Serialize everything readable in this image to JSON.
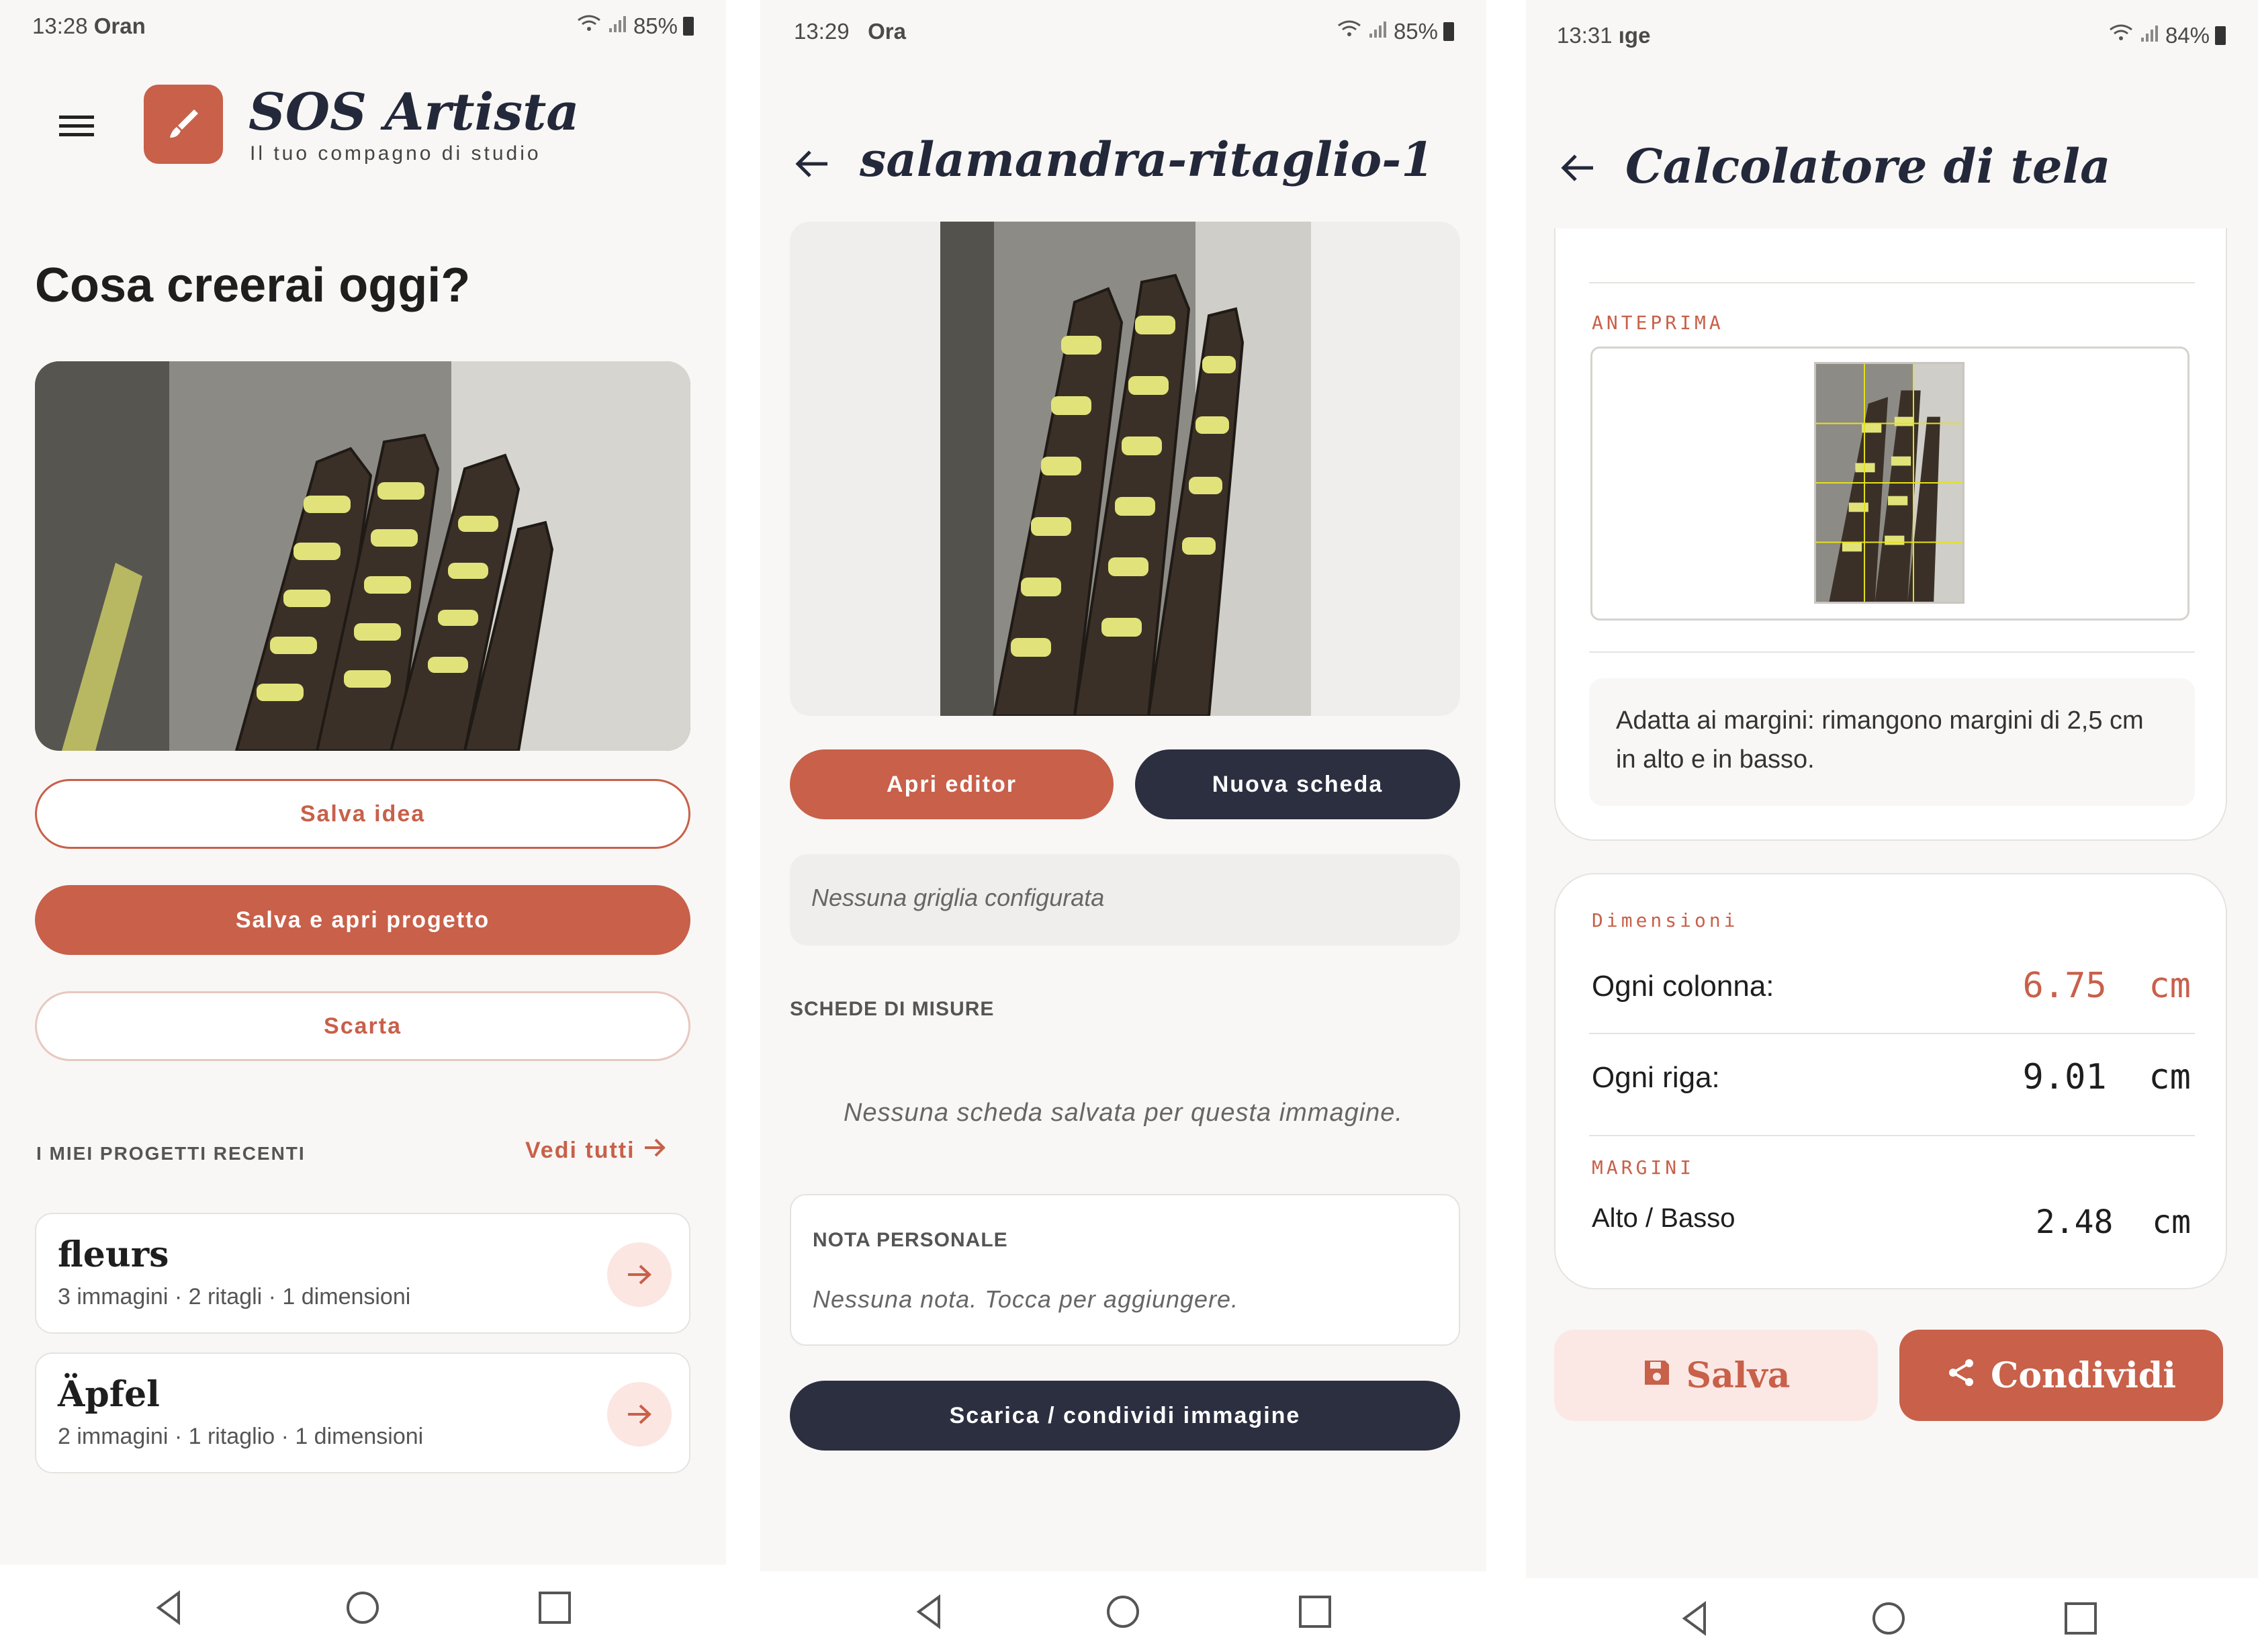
{
  "screen1": {
    "status": {
      "time": "13:28",
      "carrier": "Oran",
      "battery": "85%"
    },
    "app_title": "SOS Artista",
    "app_subtitle": "Il tuo compagno di studio",
    "heading": "Cosa creerai oggi?",
    "buttons": {
      "save_idea": "Salva idea",
      "save_open": "Salva e apri progetto",
      "discard": "Scarta"
    },
    "recent_label": "I MIEI PROGETTI RECENTI",
    "see_all": "Vedi tutti",
    "projects": [
      {
        "name": "fleurs",
        "meta": "3 immagini · 2 ritagli · 1 dimensioni"
      },
      {
        "name": "Äpfel",
        "meta": "2 immagini · 1 ritaglio · 1 dimensioni"
      }
    ]
  },
  "screen2": {
    "status": {
      "time": "13:29",
      "carrier": "Ora",
      "battery": "85%"
    },
    "title": "salamandra-ritaglio-1",
    "buttons": {
      "open_editor": "Apri editor",
      "new_sheet": "Nuova scheda",
      "download_share": "Scarica / condividi immagine"
    },
    "grid_placeholder": "Nessuna griglia configurata",
    "sheets_label": "SCHEDE DI MISURE",
    "sheets_empty": "Nessuna scheda salvata per questa immagine.",
    "note_label": "NOTA PERSONALE",
    "note_placeholder": "Nessuna nota. Tocca per aggiungere."
  },
  "screen3": {
    "status": {
      "time": "13:31",
      "carrier": "ıge",
      "battery": "84%"
    },
    "title": "Calcolatore di tela",
    "preview_label": "ANTEPRIMA",
    "fit_message": "Adatta ai margini: rimangono margini di 2,5 cm in alto e in basso.",
    "dimensions_label": "Dimensioni",
    "rows": [
      {
        "label": "Ogni colonna:",
        "value": "6.75",
        "unit": "cm"
      },
      {
        "label": "Ogni riga:",
        "value": "9.01",
        "unit": "cm"
      }
    ],
    "margins_label": "MARGINI",
    "margin_row": {
      "label": "Alto / Basso",
      "value": "2.48",
      "unit": "cm"
    },
    "buttons": {
      "save": "Salva",
      "share": "Condividi"
    }
  },
  "colors": {
    "accent": "#c8604a",
    "navy": "#2b2f40",
    "background": "#f8f7f5",
    "accent_light": "#fbe6e2"
  },
  "icons": [
    "menu-icon",
    "brush-icon",
    "back-arrow-icon",
    "arrow-right-icon",
    "save-disk-icon",
    "share-icon",
    "wifi-icon",
    "signal-icon",
    "battery-icon",
    "nav-back-icon",
    "nav-home-icon",
    "nav-recents-icon"
  ]
}
